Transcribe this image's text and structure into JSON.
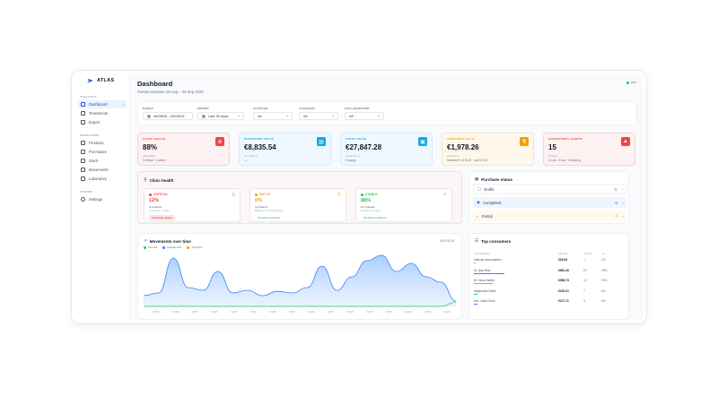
{
  "app": {
    "name": "ATLAS",
    "live": "Live"
  },
  "sidebar": {
    "sections": [
      {
        "label": "ANALYTICS",
        "items": [
          {
            "label": "Dashboard",
            "icon": "dashboard-icon",
            "active": true
          },
          {
            "label": "Treatments",
            "icon": "treatments-icon"
          },
          {
            "label": "Export",
            "icon": "export-icon"
          }
        ]
      },
      {
        "label": "OPERATIONS",
        "items": [
          {
            "label": "Products",
            "icon": "products-icon"
          },
          {
            "label": "Purchases",
            "icon": "purchases-icon"
          },
          {
            "label": "Stock",
            "icon": "stock-icon"
          },
          {
            "label": "Movements",
            "icon": "movements-icon"
          },
          {
            "label": "Laboratory",
            "icon": "laboratory-icon"
          }
        ]
      },
      {
        "label": "SYSTEM",
        "items": [
          {
            "label": "Settings",
            "icon": "gear-icon"
          }
        ]
      }
    ]
  },
  "header": {
    "title": "Dashboard",
    "subtitle": "Period overview: 05 Aug – 04 Sep 2026"
  },
  "filters": {
    "range": {
      "label": "RANGE",
      "value": "05/08/26 - 04/09/26"
    },
    "period": {
      "label": "PERIOD",
      "value": "Last 30 days"
    },
    "supplier": {
      "label": "SUPPLIER",
      "value": "All"
    },
    "category": {
      "label": "CATEGORY",
      "value": "All"
    },
    "collaborator": {
      "label": "COLLABORATOR",
      "value": "All"
    }
  },
  "kpis": [
    {
      "label": "CLINIC HEALTH",
      "value": "88%",
      "sub1": "Alertability",
      "sub2": "2 critical · 3 watch",
      "color": "#ef4444",
      "bg": "#fdf1f1",
      "border": "#f7d4d4",
      "icon": "alert-circle-icon"
    },
    {
      "label": "PURCHASED VALUE",
      "value": "€8,835.54",
      "sub1": "14 ordered",
      "sub2": "—",
      "color": "#0ea5e9",
      "bg": "#eff8fe",
      "border": "#d3ebfa",
      "icon": "cart-icon"
    },
    {
      "label": "STOCK VALUE",
      "value": "€27,847.28",
      "sub1": "Inventory of",
      "sub2": "5 supply",
      "color": "#0ea5e9",
      "bg": "#eff8fe",
      "border": "#d3ebfa",
      "icon": "box-icon"
    },
    {
      "label": "CONSUMED VALUE",
      "value": "€1,978.26",
      "sub1": "Attributed",
      "sub2": "Material € 1,978.26 · Lab € 0.00",
      "color": "#f59e0b",
      "bg": "#fef8ec",
      "border": "#f8e6c2",
      "icon": "flask-icon"
    },
    {
      "label": "OPERATIONAL ALERTS",
      "value": "15",
      "sub1": "Today's",
      "sub2": "10 crit · 5 low · 0 expiring",
      "color": "#ef4444",
      "bg": "#fdf1f1",
      "border": "#f7d4d4",
      "icon": "warning-icon"
    }
  ],
  "clinic_health": {
    "title": "Clinic health",
    "cards": [
      {
        "label": "CRITICAL",
        "pct": "12%",
        "line1": "2 products",
        "line2": "Less than 7 days",
        "tag": "Immediate action",
        "color": "#ef4444",
        "icon": "warning-icon"
      },
      {
        "label": "WATCH",
        "pct": "0%",
        "line1": "3 products",
        "line2": "Between 7 and 14 days",
        "tag": "No action required",
        "color": "#f59e0b",
        "icon": "clock-icon"
      },
      {
        "label": "STABLE",
        "pct": "88%",
        "line1": "16 products",
        "line2": "14 days or more",
        "tag": "No action required",
        "color": "#22c55e",
        "icon": "check-icon"
      }
    ]
  },
  "purchase_status": {
    "title": "Purchase status",
    "rows": [
      {
        "label": "Drafts",
        "count": "3",
        "bg": "#ffffff",
        "color": "#6b7280"
      },
      {
        "label": "Completed",
        "count": "0",
        "bg": "#eef5fe",
        "color": "#2563eb"
      },
      {
        "label": "Partial",
        "count": "0",
        "bg": "#fffaf0",
        "color": "#f59e0b"
      }
    ]
  },
  "movements": {
    "title": "Movements over time",
    "total": "€1,978.26",
    "legend": [
      {
        "name": "Internal",
        "color": "#22c55e"
      },
      {
        "name": "Collaborator",
        "color": "#3b82f6"
      },
      {
        "name": "Transfers",
        "color": "#f59e0b"
      }
    ]
  },
  "top_consumers": {
    "title": "Top consumers",
    "headers": [
      "CONSUMER",
      "VALUE",
      "UNITS",
      "%"
    ],
    "rows": [
      {
        "name": "Internal consumption",
        "value": "€18.08",
        "units": "—",
        "pct": "1%",
        "share": 0.01,
        "color": "#9ca3af"
      },
      {
        "name": "Dr. Ana Reis",
        "value": "€961.26",
        "units": "22",
        "pct": "49%",
        "share": 0.49,
        "color": "#3b82f6"
      },
      {
        "name": "Dr. Nuno Martin",
        "value": "€598.73",
        "units": "13",
        "pct": "30%",
        "share": 0.3,
        "color": "#f59e0b"
      },
      {
        "name": "Higienista Daniel",
        "value": "€125.21",
        "units": "7",
        "pct": "6%",
        "share": 0.06,
        "color": "#22c55e"
      },
      {
        "name": "Dra. Carla Sorin",
        "value": "€117.72",
        "units": "3",
        "pct": "6%",
        "share": 0.06,
        "color": "#8b5cf6"
      }
    ]
  },
  "chart_data": {
    "type": "area",
    "title": "Movements over time",
    "x": [
      "05/08",
      "07/08",
      "09/08",
      "11/08",
      "13/08",
      "15/08",
      "17/08",
      "19/08",
      "21/08",
      "23/08",
      "25/08",
      "27/08",
      "29/08",
      "31/08",
      "02/09",
      "04/09"
    ],
    "series": [
      {
        "name": "Collaborator",
        "values": [
          20,
          25,
          90,
          35,
          30,
          65,
          25,
          30,
          20,
          28,
          25,
          35,
          75,
          30,
          55,
          85,
          95,
          65,
          80,
          55,
          45,
          10
        ]
      },
      {
        "name": "Internal",
        "values": [
          0,
          0,
          0,
          0,
          0,
          0,
          0,
          0,
          0,
          0,
          0,
          0,
          0,
          0,
          0,
          0,
          0,
          0,
          0,
          0,
          0,
          8
        ]
      },
      {
        "name": "Transfers",
        "values": [
          0,
          0,
          0,
          0,
          0,
          0,
          0,
          0,
          0,
          0,
          0,
          0,
          0,
          0,
          0,
          0,
          0,
          0,
          0,
          0,
          0,
          0
        ]
      }
    ]
  }
}
